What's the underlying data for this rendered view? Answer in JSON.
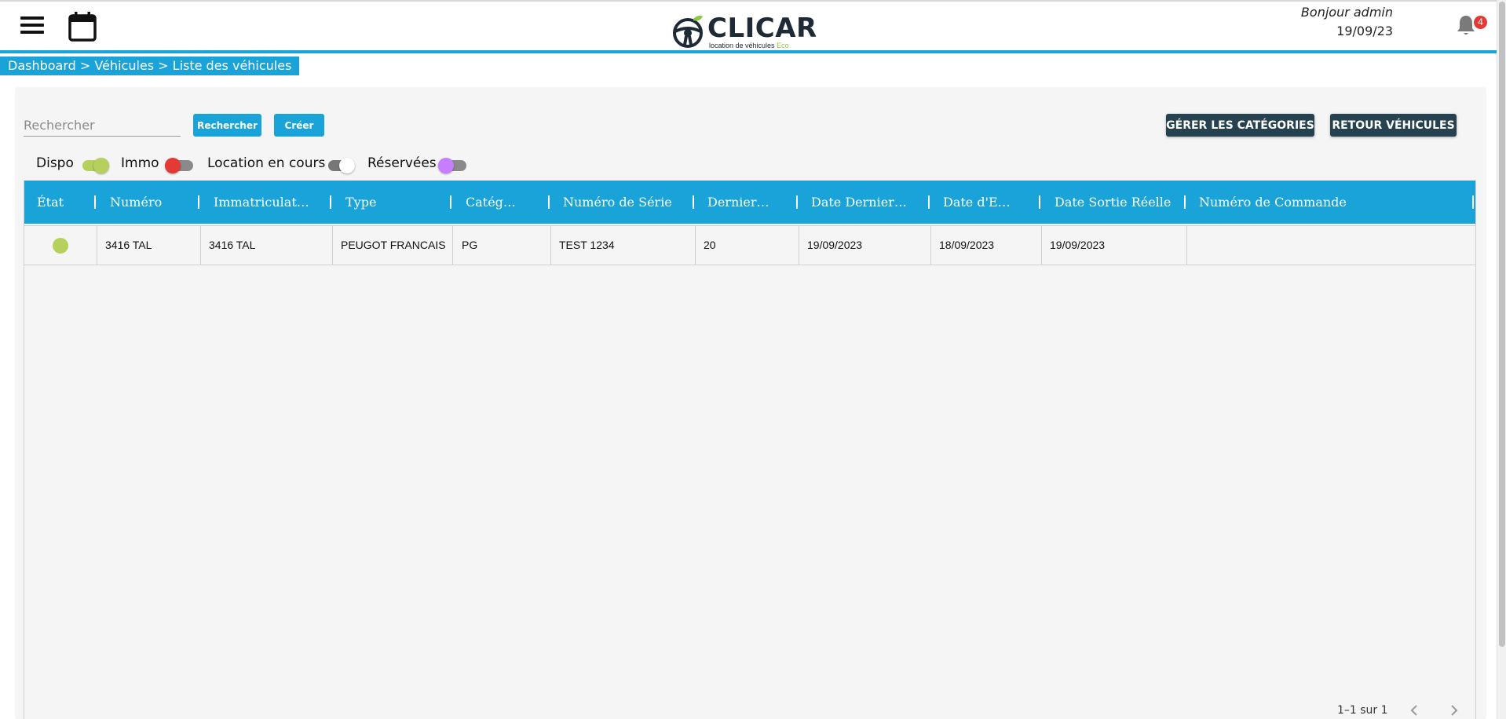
{
  "header": {
    "logo_title": "CLICAR",
    "logo_tagline": "location de véhicules",
    "logo_tagline_accent": "Eco",
    "greeting": "Bonjour admin",
    "date": "19/09/23",
    "notification_count": "4"
  },
  "icons": {
    "menu": "menu-icon",
    "calendar": "calendar-icon",
    "bell": "bell-icon",
    "prev": "chevron-left-icon",
    "next": "chevron-right-icon"
  },
  "breadcrumb": "Dashboard > Véhicules > Liste des véhicules",
  "toolbar": {
    "search_placeholder": "Rechercher",
    "search_button": "Rechercher",
    "create_button": "Créer",
    "manage_categories_button": "GÉRER LES CATÉGORIES",
    "back_vehicles_button": "RETOUR VÉHICULES"
  },
  "filters": [
    {
      "label": "Dispo",
      "color": "#b5d15b",
      "track": "#b5d15b",
      "on": true
    },
    {
      "label": "Immo",
      "color": "#e53935",
      "track": "#8a8a8a",
      "on": false
    },
    {
      "label": "Location en cours",
      "color": "#ffffff",
      "track": "#777777",
      "on": true
    },
    {
      "label": "Réservées",
      "color": "#c77dff",
      "track": "#8a8a8a",
      "on": false
    }
  ],
  "table": {
    "columns": [
      "État",
      "Numéro",
      "Immatriculat…",
      "Type",
      "Catég…",
      "Numéro de Série",
      "Dernier…",
      "Date Dernier…",
      "Date d'E…",
      "Date Sortie Réelle",
      "Numéro de Commande"
    ],
    "rows": [
      {
        "status_color": "#b5d15b",
        "cells": [
          "3416 TAL",
          "3416 TAL",
          "PEUGOT FRANCAIS",
          "PG",
          "TEST 1234",
          "20",
          "19/09/2023",
          "18/09/2023",
          "19/09/2023",
          ""
        ]
      }
    ]
  },
  "pagination": "1–1 sur 1",
  "colors": {
    "primary": "#1aa3d9",
    "dark_button": "#26414f",
    "badge": "#e53935"
  }
}
